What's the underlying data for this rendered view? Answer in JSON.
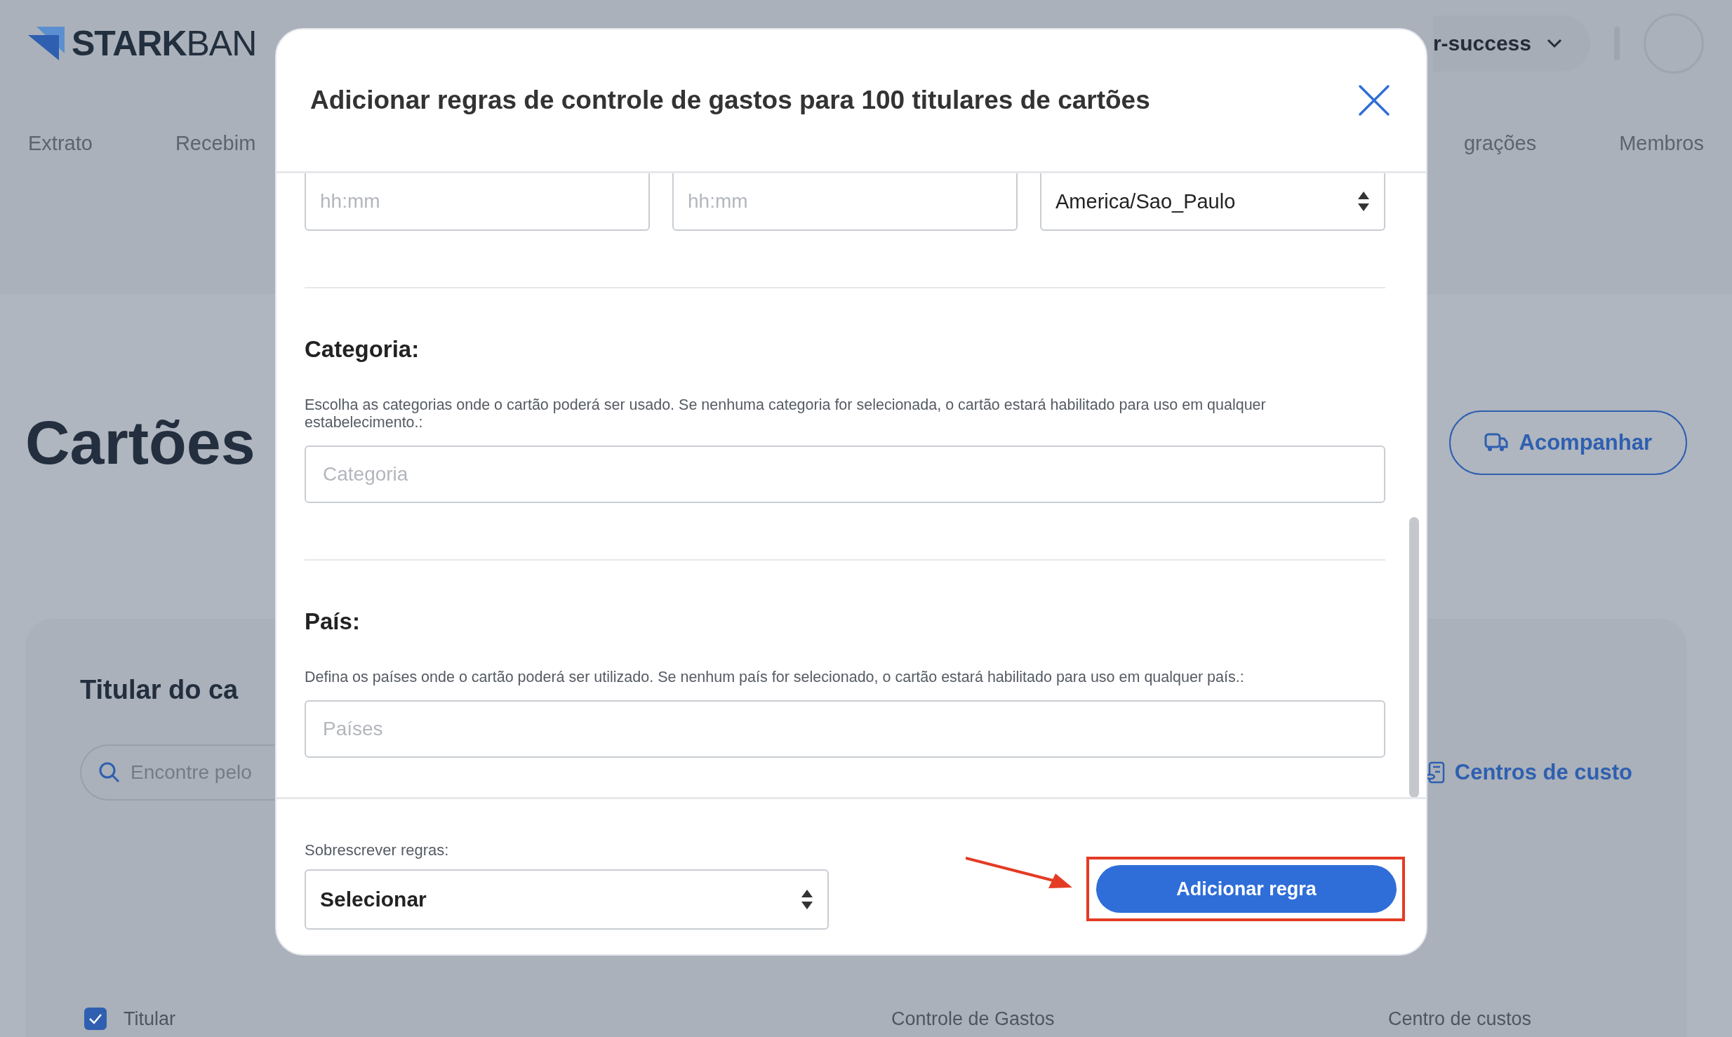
{
  "header": {
    "logo": {
      "strong": "STARK",
      "light": "BAN"
    },
    "workspace": "r-success"
  },
  "nav": {
    "left": [
      "Extrato",
      "Recebim"
    ],
    "right": [
      "grações",
      "Membros"
    ]
  },
  "page": {
    "title": "Cartões",
    "track_button": "Acompanhar"
  },
  "card": {
    "title": "Titular do ca",
    "search_placeholder": "Encontre pelo",
    "cost_centers_link": "Centros de custo",
    "select_all_checked": true,
    "columns": [
      "Titular",
      "Controle de Gastos",
      "Centro de custos"
    ]
  },
  "modal": {
    "title": "Adicionar regras de controle de gastos para 100 titulares de cartões",
    "time_row": [
      {
        "kind": "input",
        "placeholder": "hh:mm"
      },
      {
        "kind": "input",
        "placeholder": "hh:mm"
      },
      {
        "kind": "select",
        "value": "America/Sao_Paulo"
      }
    ],
    "sections": [
      {
        "label": "Categoria:",
        "description": "Escolha as categorias onde o cartão poderá ser usado. Se nenhuma categoria for selecionada, o cartão estará habilitado para uso em qualquer estabelecimento.:",
        "placeholder": "Categoria"
      },
      {
        "label": "País:",
        "description": "Defina os países onde o cartão poderá ser utilizado. Se nenhum país for selecionado, o cartão estará habilitado para uso em qualquer país.:",
        "placeholder": "Países"
      }
    ],
    "overwrite": {
      "label": "Sobrescrever regras:",
      "value": "Selecionar"
    },
    "submit": "Adicionar regra"
  }
}
